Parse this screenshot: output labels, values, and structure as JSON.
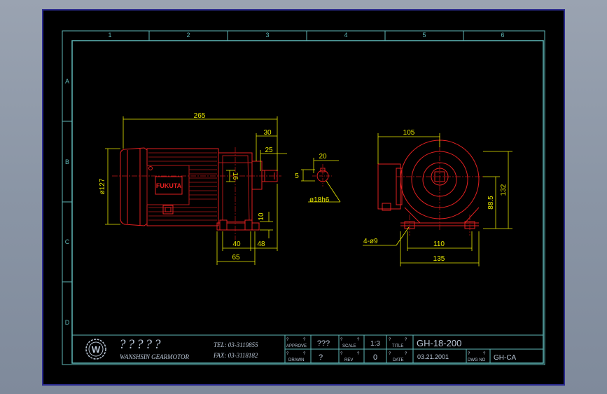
{
  "colors": {
    "sheet": "#000000",
    "border_outer": "#2b2b8f",
    "frame": "#5fb8b8",
    "dimension": "#e8e800",
    "part": "#e02020",
    "part_dark": "#b01818",
    "centerline": "#c01818",
    "title_text": "#b9c6d6"
  },
  "grid": {
    "columns": [
      "1",
      "2",
      "3",
      "4",
      "5",
      "6"
    ],
    "rows": [
      "A",
      "B",
      "C",
      "D"
    ]
  },
  "side_view": {
    "brand_label": "FUKUTA",
    "dims": {
      "overall_length": "265",
      "shaft_length": "30",
      "shaft_key": "25",
      "diameter_body": "ø127",
      "shaft_height": "16",
      "foot_height": "10",
      "foot_a": "40",
      "foot_b": "48",
      "foot_c": "65"
    }
  },
  "shaft_detail": {
    "dims": {
      "width": "20",
      "key": "5",
      "shaft_dia": "ø18h6"
    }
  },
  "front_view": {
    "dims": {
      "width_top": "105",
      "height": "132",
      "center_height": "88.5",
      "holes": "4-ø9",
      "foot_inner": "110",
      "foot_outer": "135"
    }
  },
  "title_block": {
    "logo_letter": "W",
    "company_cjk": "?????",
    "company_name": "WANSHSIN GEARMOTOR",
    "tel": "TEL: 03-3119855",
    "fax": "FAX: 03-3118182",
    "approve_label": "APPROVE",
    "approve_value": "???",
    "drawn_label": "DRAWN",
    "drawn_value": "?",
    "scale_label": "SCALE",
    "scale_value": "1:3",
    "rev_label": "REV",
    "rev_value": "0",
    "title_label": "TITLE",
    "title_value": "GH-18-200",
    "date_label": "DATE",
    "date_value": "03.21.2001",
    "dwg_label": "DWG NO",
    "dwg_value": "GH-CA",
    "q": "?"
  }
}
